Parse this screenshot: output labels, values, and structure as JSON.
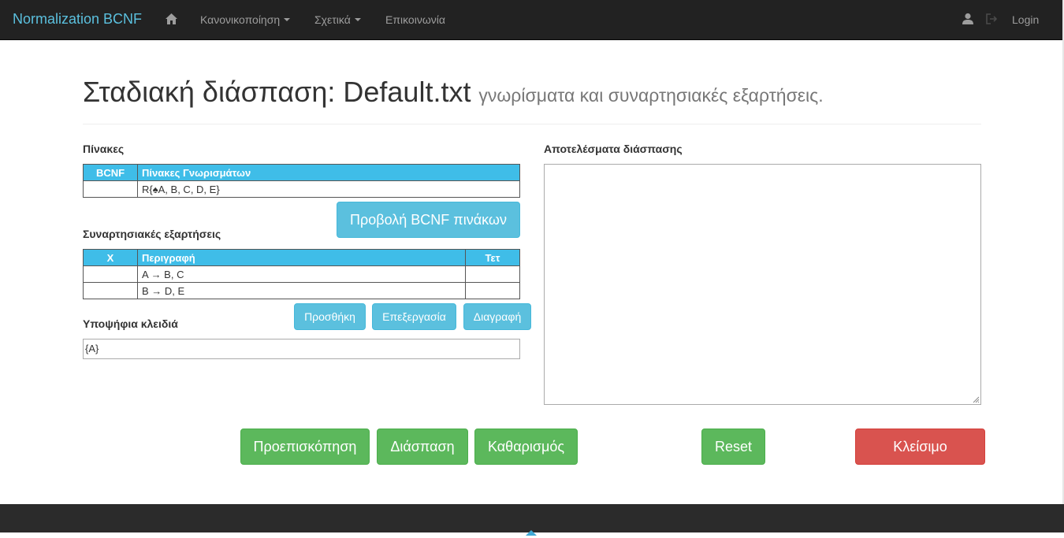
{
  "navbar": {
    "brand": "Normalization BCNF",
    "home_icon": "home-icon",
    "menu": [
      {
        "label": "Κανονικοποίηση"
      },
      {
        "label": "Σχετικά"
      },
      {
        "label": "Επικοινωνία"
      }
    ],
    "user_icon": "user-icon",
    "logout_icon": "logout-icon",
    "login_label": "Login"
  },
  "header": {
    "title": "Σταδιακή διάσπαση: Default.txt",
    "subtitle": "γνωρίσματα και συναρτησιακές εξαρτήσεις."
  },
  "tables_section": {
    "label": "Πίνακες",
    "columns": [
      "BCNF",
      "Πίνακες Γνωρισμάτων"
    ],
    "rows": [
      {
        "bcnf": "",
        "attrs": "R{♠A, B, C, D, E}"
      }
    ],
    "view_button": "Προβολή BCNF πινάκων"
  },
  "fd_section": {
    "label": "Συναρτησιακές εξαρτήσεις",
    "columns": [
      "X",
      "Περιγραφή",
      "Τετ"
    ],
    "rows": [
      {
        "x": "",
        "desc": "A → B, C",
        "tet": ""
      },
      {
        "x": "",
        "desc": "B → D, E",
        "tet": ""
      }
    ],
    "add_button": "Προσθήκη",
    "edit_button": "Επεξεργασία",
    "delete_button": "Διαγραφή"
  },
  "keys_section": {
    "label": "Υποψήφια κλειδιά",
    "value": "{A}"
  },
  "results": {
    "label": "Αποτελέσματα διάσπασης",
    "value": ""
  },
  "actions": {
    "preview": "Προεπισκόπηση",
    "decompose": "Διάσπαση",
    "clear": "Καθαρισμός",
    "reset": "Reset",
    "close": "Κλείσιμο"
  },
  "colors": {
    "navbar_bg": "#222222",
    "brand": "#5bc0de",
    "table_header": "#3fbde8",
    "info": "#5bc0de",
    "success": "#5cb85c",
    "danger": "#d9534f"
  }
}
